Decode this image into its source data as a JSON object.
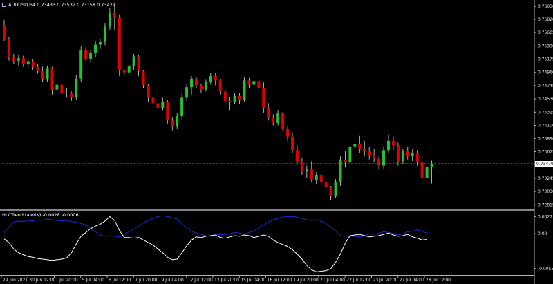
{
  "header": {
    "main_title": "AUDUSD,H4  0.73433 0.73532 0.73158 0.73479",
    "indicator_title": "HLCTrend (alerts) -0.0028 -0.0006"
  },
  "colors": {
    "background": "#000000",
    "bull_candle": "#22c232",
    "bear_candle": "#e00000",
    "wick": "#d9d9d9",
    "separator": "#b0b0b0",
    "price_line": "#9aa0a6",
    "indicator_line_1": "#1e2bd8",
    "indicator_line_2": "#ffffff",
    "text": "#e6e6e6"
  },
  "chart_data": [
    {
      "type": "candlestick",
      "symbol": "AUDUSD",
      "timeframe": "H4",
      "ohlc_header": {
        "open": 0.73433,
        "high": 0.73532,
        "low": 0.73158,
        "close": 0.73479
      },
      "current_price": "0.73479",
      "y_ticks": [
        "0.76030",
        "0.75820",
        "0.75605",
        "0.75390",
        "0.75175",
        "0.74960",
        "0.74745",
        "0.74530",
        "0.74315",
        "0.74100",
        "0.73890",
        "0.73675",
        "0.73460",
        "0.73245",
        "0.73030",
        "0.72815"
      ],
      "ylim": [
        0.7274,
        0.7611
      ],
      "candles": [
        [
          0.7572,
          0.7581,
          0.7546,
          0.755
        ],
        [
          0.755,
          0.7553,
          0.7515,
          0.752
        ],
        [
          0.752,
          0.7526,
          0.751,
          0.7515
        ],
        [
          0.7515,
          0.7524,
          0.7507,
          0.7519
        ],
        [
          0.7519,
          0.7523,
          0.7505,
          0.7509
        ],
        [
          0.7509,
          0.7518,
          0.7502,
          0.7513
        ],
        [
          0.7513,
          0.7517,
          0.75,
          0.7505
        ],
        [
          0.7505,
          0.751,
          0.7494,
          0.7498
        ],
        [
          0.7498,
          0.7505,
          0.748,
          0.7485
        ],
        [
          0.7485,
          0.7507,
          0.748,
          0.7502
        ],
        [
          0.7502,
          0.7505,
          0.746,
          0.7468
        ],
        [
          0.7468,
          0.7481,
          0.7463,
          0.7476
        ],
        [
          0.7476,
          0.7482,
          0.7455,
          0.7463
        ],
        [
          0.7463,
          0.747,
          0.7455,
          0.7462
        ],
        [
          0.7462,
          0.7465,
          0.745,
          0.7455
        ],
        [
          0.7455,
          0.7492,
          0.7452,
          0.7486
        ],
        [
          0.7486,
          0.7538,
          0.748,
          0.7532
        ],
        [
          0.7532,
          0.7537,
          0.7513,
          0.7518
        ],
        [
          0.7518,
          0.7532,
          0.7512,
          0.7528
        ],
        [
          0.7528,
          0.7546,
          0.752,
          0.7541
        ],
        [
          0.7541,
          0.755,
          0.7534,
          0.7545
        ],
        [
          0.7545,
          0.7575,
          0.754,
          0.757
        ],
        [
          0.757,
          0.76,
          0.7565,
          0.7592
        ],
        [
          0.7592,
          0.7608,
          0.7565,
          0.7585
        ],
        [
          0.7585,
          0.759,
          0.749,
          0.75
        ],
        [
          0.75,
          0.7504,
          0.749,
          0.7496
        ],
        [
          0.7496,
          0.751,
          0.749,
          0.7506
        ],
        [
          0.7506,
          0.7526,
          0.75,
          0.7522
        ],
        [
          0.7522,
          0.7525,
          0.749,
          0.7498
        ],
        [
          0.7498,
          0.75,
          0.747,
          0.7475
        ],
        [
          0.7475,
          0.7477,
          0.7448,
          0.7455
        ],
        [
          0.7455,
          0.7462,
          0.744,
          0.7446
        ],
        [
          0.7446,
          0.7452,
          0.743,
          0.7438
        ],
        [
          0.7438,
          0.7455,
          0.7435,
          0.7448
        ],
        [
          0.7448,
          0.7452,
          0.7412,
          0.7418
        ],
        [
          0.7418,
          0.7424,
          0.7402,
          0.7408
        ],
        [
          0.7408,
          0.743,
          0.7404,
          0.7425
        ],
        [
          0.7425,
          0.7462,
          0.742,
          0.7455
        ],
        [
          0.7455,
          0.7478,
          0.745,
          0.7472
        ],
        [
          0.7472,
          0.749,
          0.746,
          0.7486
        ],
        [
          0.7486,
          0.7488,
          0.747,
          0.7475
        ],
        [
          0.7475,
          0.7478,
          0.7462,
          0.7468
        ],
        [
          0.7468,
          0.7484,
          0.7465,
          0.748
        ],
        [
          0.748,
          0.7495,
          0.7476,
          0.749
        ],
        [
          0.749,
          0.7495,
          0.7475,
          0.7483
        ],
        [
          0.7483,
          0.7485,
          0.746,
          0.7465
        ],
        [
          0.7465,
          0.747,
          0.744,
          0.745
        ],
        [
          0.745,
          0.7456,
          0.7435,
          0.7448
        ],
        [
          0.7448,
          0.7462,
          0.7444,
          0.7458
        ],
        [
          0.7458,
          0.7462,
          0.7445,
          0.7452
        ],
        [
          0.7452,
          0.7488,
          0.7448,
          0.7483
        ],
        [
          0.7483,
          0.7487,
          0.747,
          0.7476
        ],
        [
          0.7476,
          0.7486,
          0.747,
          0.7482
        ],
        [
          0.7482,
          0.7486,
          0.7465,
          0.747
        ],
        [
          0.747,
          0.748,
          0.743,
          0.7438
        ],
        [
          0.7438,
          0.7446,
          0.7418,
          0.7422
        ],
        [
          0.7422,
          0.7428,
          0.741,
          0.7414
        ],
        [
          0.7414,
          0.7435,
          0.741,
          0.743
        ],
        [
          0.743,
          0.7432,
          0.74,
          0.7404
        ],
        [
          0.7404,
          0.7408,
          0.7385,
          0.7392
        ],
        [
          0.7392,
          0.7398,
          0.7365,
          0.737
        ],
        [
          0.737,
          0.7378,
          0.7348,
          0.7352
        ],
        [
          0.7352,
          0.7358,
          0.733,
          0.7335
        ],
        [
          0.7335,
          0.7345,
          0.7325,
          0.734
        ],
        [
          0.734,
          0.7352,
          0.7318,
          0.7322
        ],
        [
          0.7322,
          0.7334,
          0.7315,
          0.733
        ],
        [
          0.733,
          0.7333,
          0.7312,
          0.7318
        ],
        [
          0.7318,
          0.7325,
          0.73,
          0.731
        ],
        [
          0.731,
          0.7312,
          0.7289,
          0.7295
        ],
        [
          0.7295,
          0.7323,
          0.7292,
          0.7318
        ],
        [
          0.7318,
          0.736,
          0.7312,
          0.7355
        ],
        [
          0.7355,
          0.7368,
          0.7342,
          0.735
        ],
        [
          0.735,
          0.7382,
          0.7345,
          0.7375
        ],
        [
          0.7375,
          0.7395,
          0.7368,
          0.738
        ],
        [
          0.738,
          0.7393,
          0.7365,
          0.7372
        ],
        [
          0.7372,
          0.7385,
          0.736,
          0.7368
        ],
        [
          0.7368,
          0.7375,
          0.7355,
          0.7362
        ],
        [
          0.7362,
          0.7372,
          0.735,
          0.7356
        ],
        [
          0.7356,
          0.736,
          0.7338,
          0.7345
        ],
        [
          0.7345,
          0.7375,
          0.734,
          0.737
        ],
        [
          0.737,
          0.7395,
          0.7365,
          0.7385
        ],
        [
          0.7385,
          0.7392,
          0.737,
          0.7378
        ],
        [
          0.7378,
          0.7382,
          0.7345,
          0.7352
        ],
        [
          0.7352,
          0.7372,
          0.7348,
          0.7368
        ],
        [
          0.7368,
          0.7375,
          0.7355,
          0.736
        ],
        [
          0.736,
          0.7372,
          0.7352,
          0.7365
        ],
        [
          0.7365,
          0.737,
          0.7345,
          0.735
        ],
        [
          0.735,
          0.7355,
          0.732,
          0.7325
        ],
        [
          0.7325,
          0.7347,
          0.7318,
          0.7343
        ],
        [
          0.7343,
          0.7353,
          0.7316,
          0.7348
        ]
      ],
      "x_labels": [
        "29 Jun 2021",
        "30 Jun 12:00",
        "1 Jul 20:00",
        "5 Jul 04:00",
        "6 Jul 12:00",
        "7 Jul 20:00",
        "9 Jul 04:00",
        "12 Jul 12:00",
        "13 Jul 20:00",
        "15 Jul 04:00",
        "16 Jul 12:00",
        "19 Jul 20:00",
        "21 Jul 04:00",
        "22 Jul 12:00",
        "23 Jul 20:00",
        "27 Jul 04:00",
        "28 Jul 12:00"
      ]
    },
    {
      "type": "line",
      "title": "HLCTrend (alerts) -0.0028 -0.0006",
      "y_ticks": [
        "0.0027",
        "0.00",
        "-0.0055"
      ],
      "ylim": [
        -0.0065,
        0.0035
      ],
      "series": [
        {
          "color": "blue",
          "values": [
            0.0002,
            0.001,
            0.0018,
            0.002,
            0.0019,
            0.0021,
            0.002,
            0.0022,
            0.0021,
            0.0023,
            0.0022,
            0.0021,
            0.002,
            0.0021,
            0.0019,
            0.0018,
            0.0016,
            0.0014,
            0.0008,
            0.0003,
            -0.0002,
            -0.0004,
            -0.0003,
            -0.0004,
            -0.0005,
            -0.0001,
            0.0003,
            0.0007,
            0.0012,
            0.0017,
            0.0021,
            0.0024,
            0.0027,
            0.0028,
            0.0027,
            0.0025,
            0.0023,
            0.0016,
            0.0009,
            0.0004,
            0.0001,
            -0.0001,
            -0.0003,
            -0.0004,
            -0.0002,
            -0.0001,
            -0.0002,
            0.0,
            0.0002,
            0.0001,
            -0.0001,
            0.0002,
            0.0004,
            0.0009,
            0.0014,
            0.0018,
            0.0022,
            0.0024,
            0.0026,
            0.0027,
            0.0027,
            0.0026,
            0.0024,
            0.0022,
            0.0021,
            0.0022,
            0.002,
            0.0016,
            0.001,
            0.0004,
            -0.0003,
            -0.0004,
            -0.0004,
            -0.0004,
            -0.0005,
            -0.0003,
            0.0,
            -0.0001,
            0.0001,
            0.0003,
            0.0002,
            0.0,
            -0.0002,
            0.0,
            0.0003,
            0.0004,
            0.0006,
            0.0004,
            0.0001
          ]
        },
        {
          "color": "white",
          "values": [
            -0.0008,
            -0.0014,
            -0.0024,
            -0.003,
            -0.0033,
            -0.0036,
            -0.0037,
            -0.0039,
            -0.004,
            -0.0041,
            -0.0042,
            -0.0041,
            -0.004,
            -0.0038,
            -0.003,
            -0.0016,
            -0.0004,
            0.0002,
            0.0008,
            0.0012,
            0.0015,
            0.002,
            0.0027,
            0.0021,
            0.0005,
            -0.0006,
            -0.0006,
            -0.0007,
            -0.0006,
            -0.001,
            -0.0014,
            -0.0018,
            -0.0024,
            -0.003,
            -0.0037,
            -0.0041,
            -0.004,
            -0.003,
            -0.0019,
            -0.001,
            -0.0005,
            -0.0006,
            -0.0004,
            -0.0003,
            -0.0002,
            -0.0006,
            -0.0007,
            -0.0005,
            -0.0003,
            -0.0004,
            -0.0002,
            -0.0003,
            -0.0006,
            -0.0004,
            -0.0002,
            -0.0004,
            -0.001,
            -0.0014,
            -0.0017,
            -0.002,
            -0.0025,
            -0.0032,
            -0.004,
            -0.005,
            -0.0057,
            -0.006,
            -0.0059,
            -0.0058,
            -0.0055,
            -0.0045,
            -0.0032,
            -0.0015,
            -0.0003,
            -0.0002,
            -0.0001,
            -0.0003,
            -0.0005,
            -0.0004,
            -0.0003,
            -0.0001,
            0.0001,
            -0.0002,
            -0.0004,
            -0.0003,
            -0.0001,
            -0.0005,
            -0.0007,
            -0.001,
            -0.0009
          ]
        }
      ]
    }
  ]
}
